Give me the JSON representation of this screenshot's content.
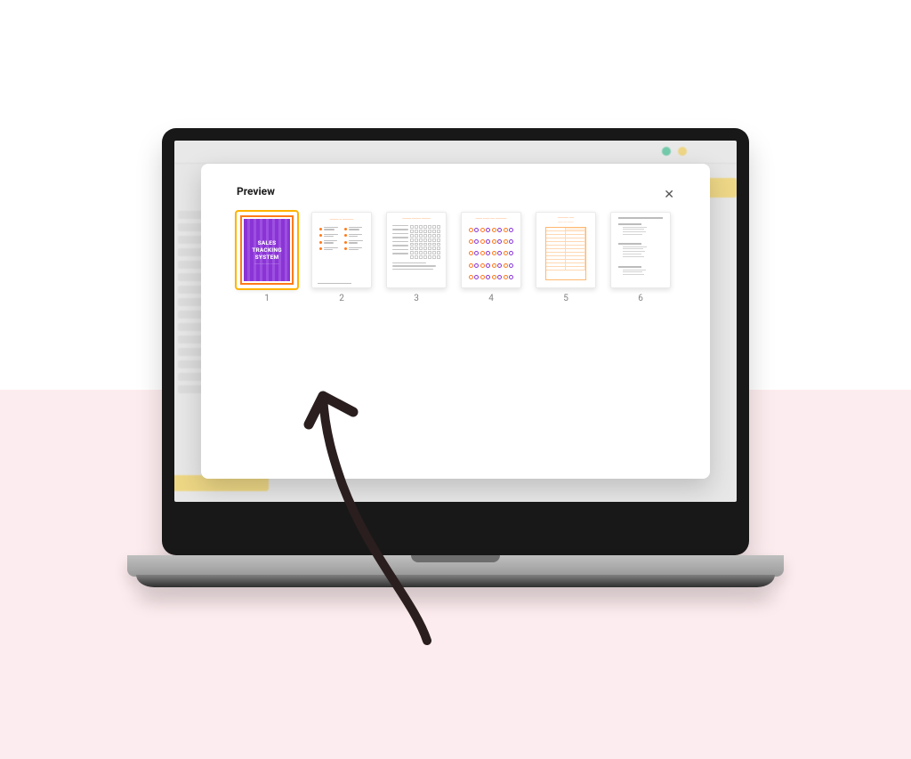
{
  "modal": {
    "title": "Preview"
  },
  "pages": [
    {
      "number": "1",
      "name": "cover",
      "selected": true,
      "title_line1": "SALES",
      "title_line2": "TRACKING",
      "title_line3": "SYSTEM"
    },
    {
      "number": "2",
      "name": "page-2",
      "selected": false
    },
    {
      "number": "3",
      "name": "page-3",
      "selected": false
    },
    {
      "number": "4",
      "name": "page-4",
      "selected": false
    },
    {
      "number": "5",
      "name": "page-5",
      "selected": false
    },
    {
      "number": "6",
      "name": "page-6",
      "selected": false
    }
  ],
  "colors": {
    "accent_purple": "#8a34d6",
    "accent_orange": "#ff7a1a",
    "selection_yellow": "#ffb300",
    "page_band_pink": "#fdecef"
  }
}
